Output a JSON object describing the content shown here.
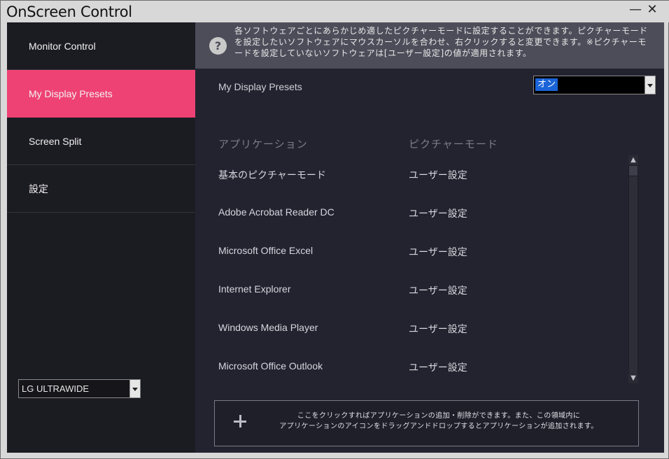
{
  "window": {
    "title": "OnScreen Control",
    "minimize_glyph": "—",
    "close_glyph": "✕"
  },
  "sidebar": {
    "items": [
      {
        "label": "Monitor Control",
        "active": false
      },
      {
        "label": "My Display Presets",
        "active": true
      },
      {
        "label": "Screen Split",
        "active": false
      },
      {
        "label": "設定",
        "active": false
      }
    ],
    "monitor_select": {
      "value": "LG ULTRAWIDE"
    }
  },
  "info": {
    "icon": "help-icon",
    "icon_glyph": "?",
    "text": "各ソフトウェアごとにあらかじめ適したピクチャーモードに設定することができます。ピクチャーモードを設定したいソフトウェアにマウスカーソルを合わせ、右クリックすると変更できます。※ピクチャーモードを設定していないソフトウェアは[ユーザー設定]の値が適用されます。"
  },
  "presets": {
    "label": "My Display Presets",
    "toggle_value": "オン"
  },
  "table": {
    "headers": {
      "application": "アプリケーション",
      "picture_mode": "ピクチャーモード"
    },
    "rows": [
      {
        "app": "基本のピクチャーモード",
        "mode": "ユーザー設定"
      },
      {
        "app": "Adobe Acrobat Reader DC",
        "mode": "ユーザー設定"
      },
      {
        "app": "Microsoft Office Excel",
        "mode": "ユーザー設定"
      },
      {
        "app": "Internet Explorer",
        "mode": "ユーザー設定"
      },
      {
        "app": "Windows Media Player",
        "mode": "ユーザー設定"
      },
      {
        "app": "Microsoft Office Outlook",
        "mode": "ユーザー設定"
      }
    ]
  },
  "scrollbar": {
    "up_glyph": "▲",
    "down_glyph": "▼"
  },
  "add_area": {
    "line1": "ここをクリックすればアプリケーションの追加・削除ができます。また、この領域内に",
    "line2": "アプリケーションのアイコンをドラッグアンドドロップするとアプリケーションが追加されます。"
  },
  "colors": {
    "accent": "#ef4274",
    "sidebar_bg": "#1b1b22",
    "main_bg": "#232330",
    "info_bg": "#4d4d5a",
    "selection": "#1a64d8"
  }
}
